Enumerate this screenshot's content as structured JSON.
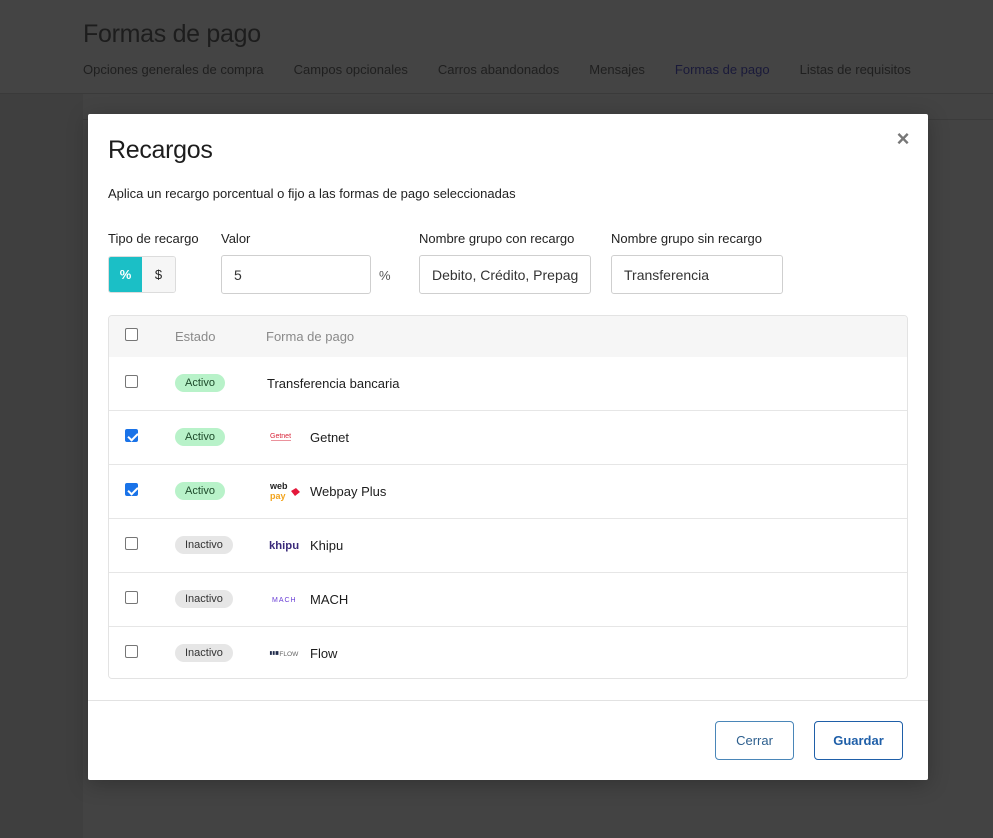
{
  "background": {
    "title": "Formas de pago",
    "tabs": [
      {
        "label": "Opciones generales de compra"
      },
      {
        "label": "Campos opcionales"
      },
      {
        "label": "Carros abandonados"
      },
      {
        "label": "Mensajes"
      },
      {
        "label": "Formas de pago",
        "active": true
      },
      {
        "label": "Listas de requisitos"
      }
    ]
  },
  "modal": {
    "title": "Recargos",
    "close_label": "×",
    "description": "Aplica un recargo porcentual o fijo a las formas de pago seleccionadas",
    "fields": {
      "tipo_label": "Tipo de recargo",
      "tipo_options": [
        "%",
        "$"
      ],
      "tipo_selected": "%",
      "valor_label": "Valor",
      "valor_value": "5",
      "valor_suffix": "%",
      "grupo_con_label": "Nombre grupo con recargo",
      "grupo_con_value": "Debito, Crédito, Prepago",
      "grupo_sin_label": "Nombre grupo sin recargo",
      "grupo_sin_value": "Transferencia"
    },
    "table": {
      "headers": {
        "estado": "Estado",
        "forma": "Forma de pago"
      },
      "rows": [
        {
          "checked": false,
          "estado": "Activo",
          "nombre": "Transferencia bancaria",
          "logo": ""
        },
        {
          "checked": true,
          "estado": "Activo",
          "nombre": "Getnet",
          "logo": "getnet"
        },
        {
          "checked": true,
          "estado": "Activo",
          "nombre": "Webpay Plus",
          "logo": "webpay"
        },
        {
          "checked": false,
          "estado": "Inactivo",
          "nombre": "Khipu",
          "logo": "khipu"
        },
        {
          "checked": false,
          "estado": "Inactivo",
          "nombre": "MACH",
          "logo": "mach"
        },
        {
          "checked": false,
          "estado": "Inactivo",
          "nombre": "Flow",
          "logo": "flow"
        }
      ]
    },
    "buttons": {
      "cerrar": "Cerrar",
      "guardar": "Guardar"
    }
  },
  "colors": {
    "accent": "#1bbfc6",
    "active_badge": "#b8f2c9",
    "inactive_badge": "#e6e6e6",
    "primary_button": "#1f5fa8"
  }
}
